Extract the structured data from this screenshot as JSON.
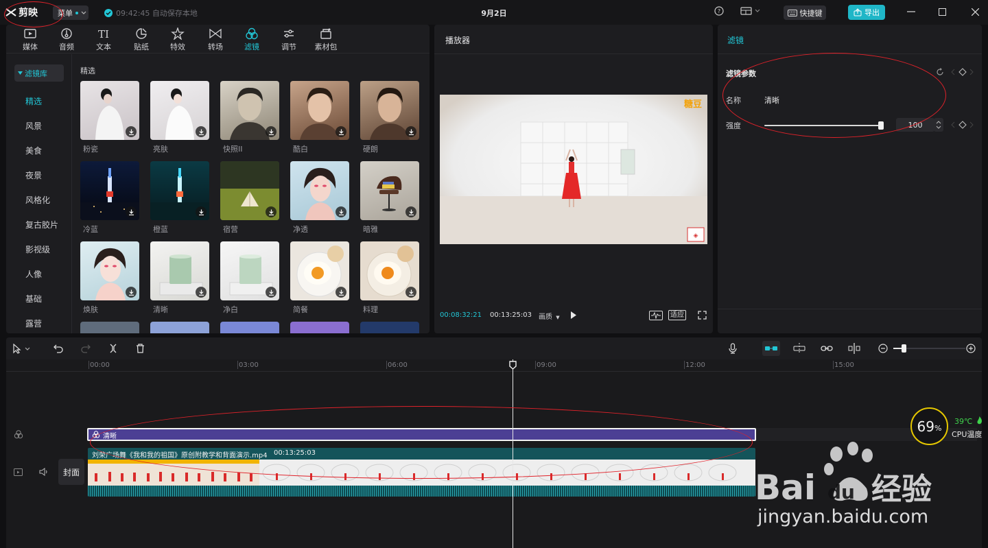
{
  "topbar": {
    "app_name": "剪映",
    "menu_label": "菜单",
    "autosave_text": "09:42:45 自动保存本地",
    "document_title": "9月2日",
    "shortcuts_label": "快捷键",
    "export_label": "导出"
  },
  "media_tabs": [
    {
      "label": "媒体",
      "icon": "media-icon"
    },
    {
      "label": "音频",
      "icon": "audio-icon"
    },
    {
      "label": "文本",
      "icon": "text-icon"
    },
    {
      "label": "贴纸",
      "icon": "sticker-icon"
    },
    {
      "label": "特效",
      "icon": "effects-icon"
    },
    {
      "label": "转场",
      "icon": "transition-icon"
    },
    {
      "label": "滤镜",
      "icon": "filter-icon",
      "active": true
    },
    {
      "label": "调节",
      "icon": "adjust-icon"
    },
    {
      "label": "素材包",
      "icon": "package-icon"
    }
  ],
  "filter_library": {
    "header": "滤镜库",
    "categories": [
      "精选",
      "风景",
      "美食",
      "夜景",
      "风格化",
      "复古胶片",
      "影视级",
      "人像",
      "基础",
      "露营"
    ],
    "active_category": "精选",
    "section_label": "精选",
    "items": [
      "粉瓷",
      "亮肤",
      "快照II",
      "酷白",
      "硬朗",
      "冷蓝",
      "橙蓝",
      "宿营",
      "净透",
      "暗雅",
      "焕肤",
      "清晰",
      "净白",
      "简餐",
      "料理"
    ]
  },
  "player": {
    "title": "播放器",
    "current_time": "00:08:32:21",
    "total_time": "00:13:25:03",
    "quality_label": "画质",
    "ratio_label": "适应",
    "video_logo_text": "糖豆"
  },
  "filter_panel": {
    "title": "滤镜",
    "params_label": "滤镜参数",
    "name_label": "名称",
    "name_value": "清晰",
    "intensity_label": "强度",
    "intensity_value": "100",
    "intensity_percent": 100
  },
  "timeline": {
    "ruler_labels": [
      "00:00",
      "03:00",
      "06:00",
      "09:00",
      "12:00",
      "15:00"
    ],
    "filter_clip_label": "清晰",
    "video_clip_name": "刘荣广场舞《我和我的祖国》原创附教学和背面演示.mp4",
    "video_clip_duration": "00:13:25:03",
    "cover_label": "封面"
  },
  "cpu": {
    "usage": "69",
    "usage_unit": "%",
    "temperature": "39℃",
    "label": "CPU温度"
  },
  "watermark": {
    "brand": "Bai",
    "brand2": "du",
    "chinese": "经验",
    "url": "jingyan.baidu.com"
  },
  "colors": {
    "accent": "#22c6d6",
    "filter_track": "#4c3f94",
    "video_track": "#14545a",
    "annotation": "#e0222a",
    "cpu_ring": "#e6c800",
    "cpu_temp": "#3fd24c"
  }
}
